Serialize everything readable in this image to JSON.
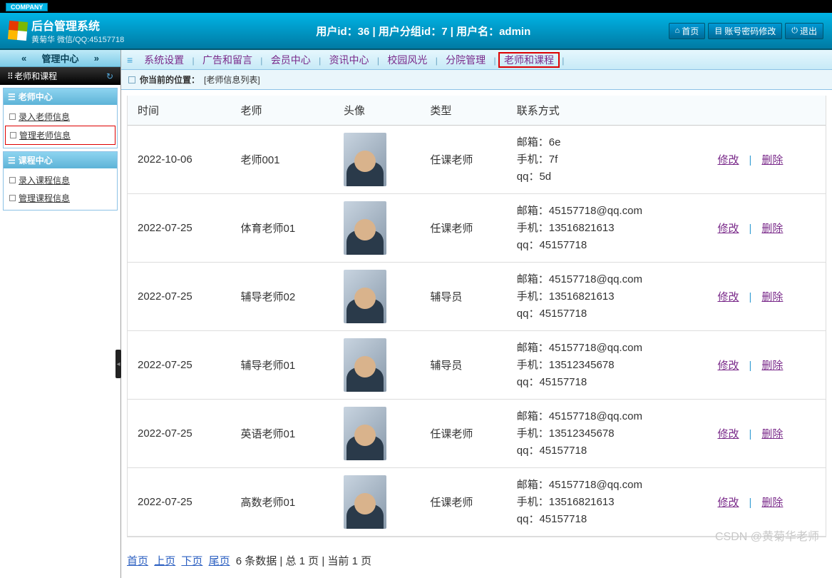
{
  "company_tag": "COMPANY",
  "app_title": "后台管理系统",
  "app_sub": "黄菊华 微信/QQ:45157718",
  "header_info": "用户id：36 | 用户分组id：7 | 用户名：admin",
  "header_buttons": {
    "home": "首页",
    "pwd": "账号密码修改",
    "exit": "退出"
  },
  "mgmt_center": "管理中心",
  "tree_title": "老师和课程",
  "side_groups": [
    {
      "title": "老师中心",
      "items": [
        {
          "label": "录入老师信息",
          "sel": false
        },
        {
          "label": "管理老师信息",
          "sel": true
        }
      ]
    },
    {
      "title": "课程中心",
      "items": [
        {
          "label": "录入课程信息",
          "sel": false
        },
        {
          "label": "管理课程信息",
          "sel": false
        }
      ]
    }
  ],
  "top_nav": [
    {
      "label": "系统设置",
      "hl": false
    },
    {
      "label": "广告和留言",
      "hl": false
    },
    {
      "label": "会员中心",
      "hl": false
    },
    {
      "label": "资讯中心",
      "hl": false
    },
    {
      "label": "校园风光",
      "hl": false
    },
    {
      "label": "分院管理",
      "hl": false
    },
    {
      "label": "老师和课程",
      "hl": true
    }
  ],
  "breadcrumb": {
    "label": "你当前的位置：",
    "val": "[老师信息列表]"
  },
  "table": {
    "headers": {
      "time": "时间",
      "teacher": "老师",
      "avatar": "头像",
      "type": "类型",
      "contact": "联系方式"
    },
    "contact_labels": {
      "email": "邮箱：",
      "phone": "手机：",
      "qq": "qq："
    },
    "action": {
      "edit": "修改",
      "del": "删除"
    },
    "rows": [
      {
        "time": "2022-10-06",
        "teacher": "老师001",
        "type": "任课老师",
        "email": "6e",
        "phone": "7f",
        "qq": "5d"
      },
      {
        "time": "2022-07-25",
        "teacher": "体育老师01",
        "type": "任课老师",
        "email": "45157718@qq.com",
        "phone": "13516821613",
        "qq": "45157718"
      },
      {
        "time": "2022-07-25",
        "teacher": "辅导老师02",
        "type": "辅导员",
        "email": "45157718@qq.com",
        "phone": "13516821613",
        "qq": "45157718"
      },
      {
        "time": "2022-07-25",
        "teacher": "辅导老师01",
        "type": "辅导员",
        "email": "45157718@qq.com",
        "phone": "13512345678",
        "qq": "45157718"
      },
      {
        "time": "2022-07-25",
        "teacher": "英语老师01",
        "type": "任课老师",
        "email": "45157718@qq.com",
        "phone": "13512345678",
        "qq": "45157718"
      },
      {
        "time": "2022-07-25",
        "teacher": "高数老师01",
        "type": "任课老师",
        "email": "45157718@qq.com",
        "phone": "13516821613",
        "qq": "45157718"
      }
    ]
  },
  "pager": {
    "first": "首页",
    "prev": "上页",
    "next": "下页",
    "last": "尾页",
    "summary": "6 条数据 | 总 1 页 | 当前 1 页"
  },
  "watermark": "CSDN @黄菊华老师"
}
